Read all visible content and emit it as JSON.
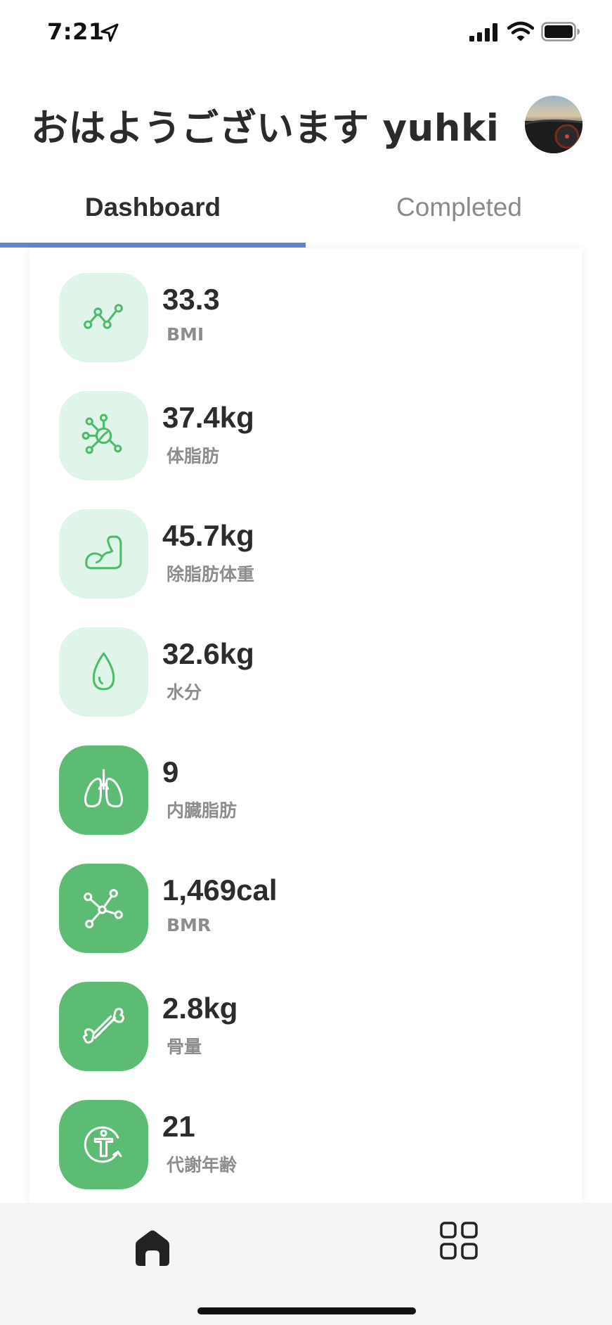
{
  "status_bar": {
    "time": "7:21",
    "icons": [
      "location-arrow-icon",
      "signal-icon",
      "wifi-icon",
      "battery-icon"
    ]
  },
  "header": {
    "greeting": "おはようございます yuhki",
    "avatar": "user-avatar"
  },
  "tabs": [
    {
      "label": "Dashboard",
      "active": true
    },
    {
      "label": "Completed",
      "active": false
    }
  ],
  "colors": {
    "accent_tab": "#5f87d6",
    "icon_light_bg": "#e0f5ea",
    "icon_dark_bg": "#5cbc73",
    "icon_green": "#4dba6c"
  },
  "metrics": [
    {
      "value": "33.3",
      "label": "BMI",
      "icon": "line-chart-icon",
      "style": "light"
    },
    {
      "value": "37.4kg",
      "label": "体脂肪",
      "icon": "molecule-icon",
      "style": "light"
    },
    {
      "value": "45.7kg",
      "label": "除脂肪体重",
      "icon": "flexed-arm-icon",
      "style": "light"
    },
    {
      "value": "32.6kg",
      "label": "水分",
      "icon": "water-drop-icon",
      "style": "light"
    },
    {
      "value": "9",
      "label": "内臓脂肪",
      "icon": "lungs-icon",
      "style": "dark"
    },
    {
      "value": "1,469cal",
      "label": "BMR",
      "icon": "network-nodes-icon",
      "style": "dark"
    },
    {
      "value": "2.8kg",
      "label": "骨量",
      "icon": "bone-icon",
      "style": "dark"
    },
    {
      "value": "21",
      "label": "代謝年齢",
      "icon": "body-cycle-icon",
      "style": "dark"
    }
  ],
  "bottom_nav": [
    {
      "icon": "home-icon",
      "active": true
    },
    {
      "icon": "grid-icon",
      "active": false
    }
  ]
}
